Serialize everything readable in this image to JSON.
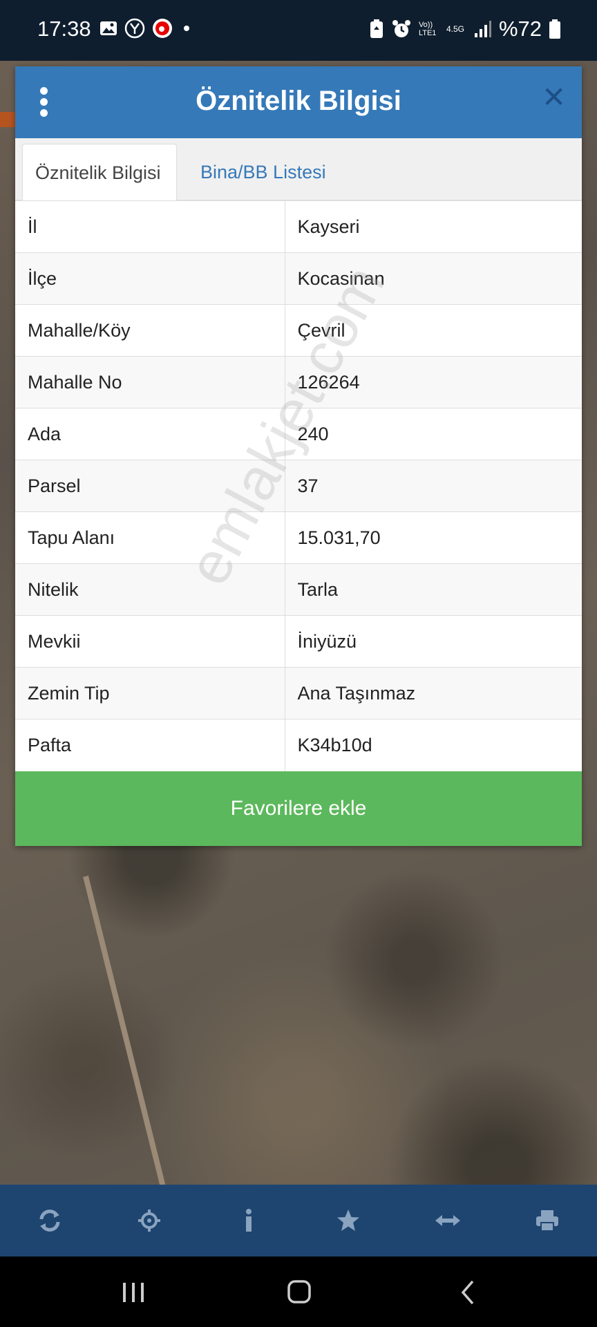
{
  "status_bar": {
    "time": "17:38",
    "battery": "%72",
    "left_icons": [
      "image-icon",
      "y-icon",
      "vodafone-icon",
      "dot-icon"
    ],
    "right_icons": [
      "battery-saver-icon",
      "alarm-icon",
      "volte-icon",
      "network-4g-icon",
      "signal-icon",
      "battery-icon"
    ],
    "volte_label": "Vo)) LTE1",
    "network_label": "4.5G"
  },
  "dialog": {
    "title": "Öznitelik Bilgisi",
    "tabs": [
      {
        "label": "Öznitelik Bilgisi",
        "active": true
      },
      {
        "label": "Bina/BB Listesi",
        "active": false
      }
    ],
    "rows": [
      {
        "key": "İl",
        "value": "Kayseri"
      },
      {
        "key": "İlçe",
        "value": "Kocasinan"
      },
      {
        "key": "Mahalle/Köy",
        "value": "Çevril"
      },
      {
        "key": "Mahalle No",
        "value": "126264"
      },
      {
        "key": "Ada",
        "value": "240"
      },
      {
        "key": "Parsel",
        "value": "37"
      },
      {
        "key": "Tapu Alanı",
        "value": "15.031,70"
      },
      {
        "key": "Nitelik",
        "value": "Tarla"
      },
      {
        "key": "Mevkii",
        "value": "İniyüzü"
      },
      {
        "key": "Zemin Tip",
        "value": "Ana Taşınmaz"
      },
      {
        "key": "Pafta",
        "value": "K34b10d"
      }
    ],
    "favorite_button": "Favorilere ekle",
    "watermark": "emlakjet.com"
  },
  "toolbar": {
    "buttons": [
      "refresh-icon",
      "locate-icon",
      "info-icon",
      "star-icon",
      "measure-icon",
      "print-icon"
    ]
  },
  "colors": {
    "header": "#3579b8",
    "button": "#5cb85c",
    "toolbar": "#1e4570"
  }
}
